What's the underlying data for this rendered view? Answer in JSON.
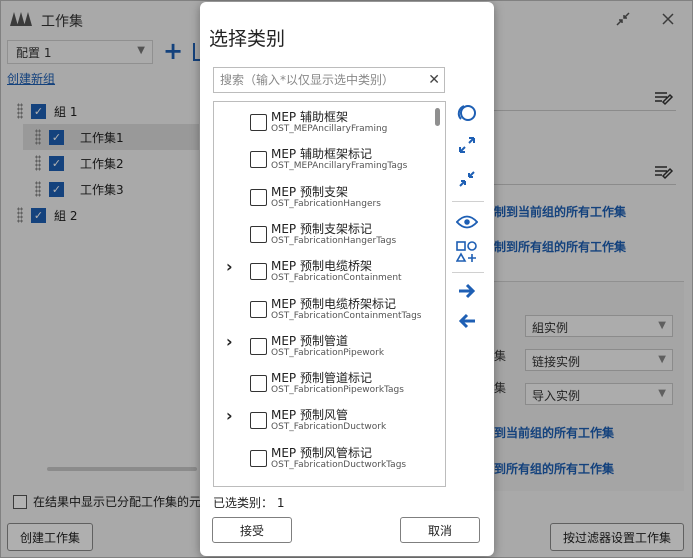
{
  "window": {
    "title": "工作集",
    "config_value": "配置 1",
    "create_group_link": "创建新组",
    "tree": [
      {
        "label": "組 1",
        "checked": true
      },
      {
        "label": "工作集1",
        "checked": true
      },
      {
        "label": "工作集2",
        "checked": true
      },
      {
        "label": "工作集3",
        "checked": true
      },
      {
        "label": "組 2",
        "checked": true
      }
    ],
    "show_assigned_label": "在结果中显示已分配工作集的元素",
    "create_workset_button": "创建工作集",
    "filter_workset_button": "按过滤器设置工作集",
    "right": {
      "link_current_group_1": "制到当前组的所有工作集",
      "link_all_groups_1": "制到所有组的所有工作集",
      "row_labels": [
        "集",
        "集"
      ],
      "selects": [
        "組实例",
        "链接实例",
        "导入实例"
      ],
      "link_current_group_2": "到当前组的所有工作集",
      "link_all_groups_2": "到所有组的所有工作集"
    }
  },
  "dialog": {
    "title": "选择类别",
    "search_placeholder": "搜索（输入*以仅显示选中类别）",
    "categories": [
      {
        "name": "MEP 辅助框架",
        "id": "OST_MEPAncillaryFraming",
        "expandable": false,
        "checked": false
      },
      {
        "name": "MEP 辅助框架标记",
        "id": "OST_MEPAncillaryFramingTags",
        "expandable": false,
        "checked": false
      },
      {
        "name": "MEP 预制支架",
        "id": "OST_FabricationHangers",
        "expandable": false,
        "checked": false
      },
      {
        "name": "MEP 预制支架标记",
        "id": "OST_FabricationHangerTags",
        "expandable": false,
        "checked": false
      },
      {
        "name": "MEP 预制电缆桥架",
        "id": "OST_FabricationContainment",
        "expandable": true,
        "checked": false
      },
      {
        "name": "MEP 预制电缆桥架标记",
        "id": "OST_FabricationContainmentTags",
        "expandable": false,
        "checked": false
      },
      {
        "name": "MEP 预制管道",
        "id": "OST_FabricationPipework",
        "expandable": true,
        "checked": false
      },
      {
        "name": "MEP 预制管道标记",
        "id": "OST_FabricationPipeworkTags",
        "expandable": false,
        "checked": false
      },
      {
        "name": "MEP 预制风管",
        "id": "OST_FabricationDuctwork",
        "expandable": true,
        "checked": false
      },
      {
        "name": "MEP 预制风管标记",
        "id": "OST_FabricationDuctworkTags",
        "expandable": false,
        "checked": false
      }
    ],
    "selected_count_text": "已选类别： 1",
    "accept_button": "接受",
    "cancel_button": "取消",
    "accent_color": "#1e5fb4"
  }
}
